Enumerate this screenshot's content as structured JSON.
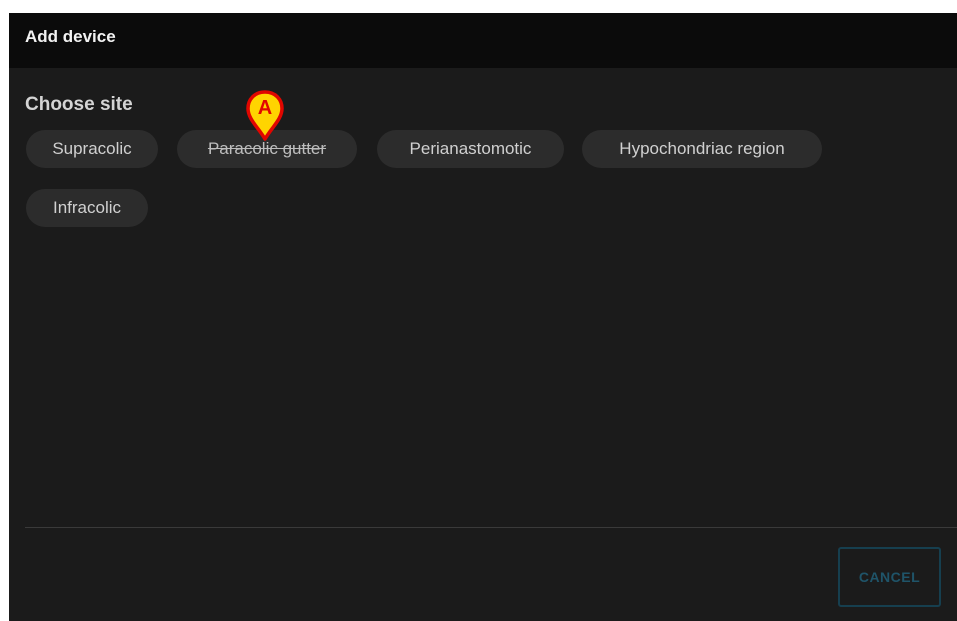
{
  "dialog": {
    "title": "Add device"
  },
  "site_section": {
    "title": "Choose site",
    "chips": [
      {
        "label": "Supracolic",
        "disabled": false
      },
      {
        "label": "Paracolic gutter",
        "disabled": true
      },
      {
        "label": "Perianastomotic",
        "disabled": false
      },
      {
        "label": "Hypochondriac region",
        "disabled": false
      },
      {
        "label": "Infracolic",
        "disabled": false
      }
    ]
  },
  "footer": {
    "cancel_label": "CANCEL"
  },
  "annotation": {
    "marker_label": "A",
    "marker_icon": "map-pin-icon",
    "marker_color": "#e10600",
    "marker_fill": "#ffd400"
  },
  "colors": {
    "dialog_background": "#1b1b1b",
    "header_background": "#0b0b0b",
    "chip_background": "#2c2c2c",
    "cancel_border": "#163f4f"
  }
}
